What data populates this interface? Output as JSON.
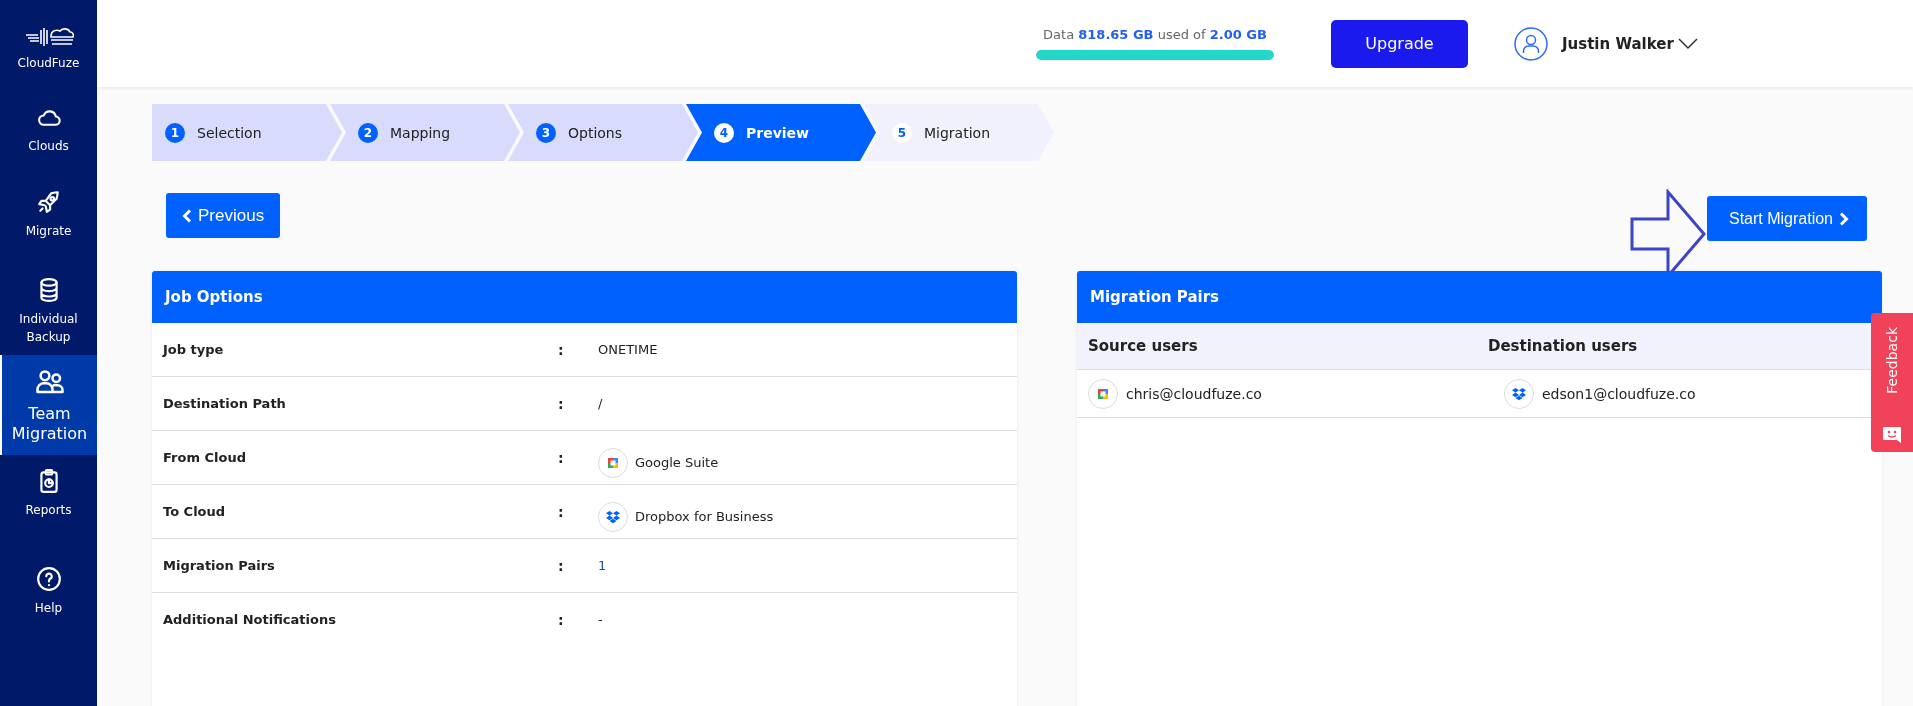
{
  "sidebar": {
    "brand": "CloudFuze",
    "items": [
      {
        "label": "Clouds",
        "kind": "cloud",
        "selected": false
      },
      {
        "label": "Migrate",
        "kind": "rocket",
        "selected": false
      },
      {
        "label": "Individual Backup",
        "kind": "database",
        "selected": false
      },
      {
        "label": "Team Migration",
        "kind": "users",
        "selected": true
      },
      {
        "label": "Reports",
        "kind": "clipboard",
        "selected": false
      },
      {
        "label": "Help",
        "kind": "help",
        "selected": false
      }
    ]
  },
  "header": {
    "usage": {
      "text": "Data **818.65 GB** used of **2.00 GB**",
      "level": 1
    },
    "upgrade_button": "Upgrade",
    "user_name": "Justin Walker"
  },
  "steps": [
    {
      "number": "1",
      "label": "Selection",
      "completed": true,
      "selected": false
    },
    {
      "number": "2",
      "label": "Mapping",
      "completed": true,
      "selected": false
    },
    {
      "number": "3",
      "label": "Options",
      "completed": true,
      "selected": false
    },
    {
      "number": "4",
      "label": "Preview",
      "completed": false,
      "selected": true
    },
    {
      "number": "5",
      "label": "Migration",
      "completed": false,
      "selected": false
    }
  ],
  "previous_button": "Previous",
  "start_button": "Start Migration",
  "job_options": {
    "title": "Job Options",
    "rows": [
      {
        "label": "Job type",
        "separator": ":",
        "value": "ONETIME",
        "kind": "text"
      },
      {
        "label": "Destination Path",
        "separator": ":",
        "value": "/",
        "kind": "text"
      },
      {
        "label": "From Cloud",
        "separator": ":",
        "value": "Google Suite",
        "kind": "google"
      },
      {
        "label": "To Cloud",
        "separator": ":",
        "value": "Dropbox for Business",
        "kind": "dropbox"
      },
      {
        "label": "Migration Pairs",
        "separator": ":",
        "value": "1",
        "kind": "count"
      },
      {
        "label": "Additional Notifications",
        "separator": ":",
        "value": "-",
        "kind": "text"
      }
    ]
  },
  "migration_pairs": {
    "title": "Migration Pairs",
    "columns": [
      "Source users",
      "Destination users"
    ],
    "rows": [
      {
        "source": {
          "kind": "google",
          "email": "chris@cloudfuze.co"
        },
        "destination": {
          "kind": "dropbox",
          "email": "edson1@cloudfuze.co"
        }
      }
    ]
  },
  "feedback": "Feedback"
}
